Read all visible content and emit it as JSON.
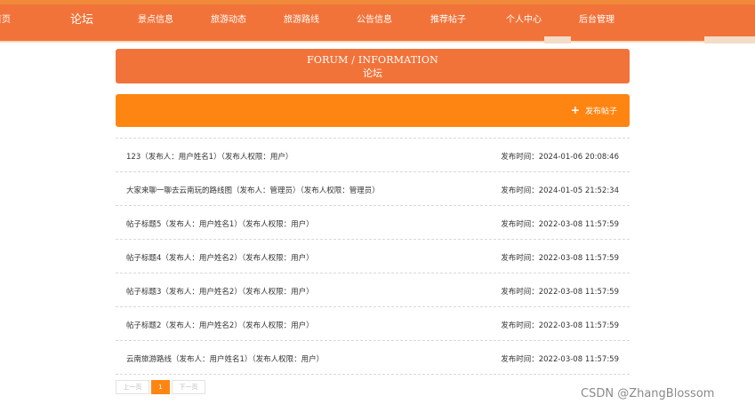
{
  "nav": {
    "items": [
      "首页",
      "论坛",
      "景点信息",
      "旅游动态",
      "旅游路线",
      "公告信息",
      "推荐帖子",
      "个人中心",
      "后台管理"
    ]
  },
  "page": {
    "title_en": "FORUM / INFORMATION",
    "title_cn": "论坛"
  },
  "actions": {
    "post_label": "发布帖子"
  },
  "posts": [
    {
      "title": "123（发布人：用户姓名1）（发布人权限：用户）",
      "time": "发布时间：2024-01-06 20:08:46"
    },
    {
      "title": "大家来聊一聊去云南玩的路线图（发布人：管理员）（发布人权限：管理员）",
      "time": "发布时间：2024-01-05 21:52:34"
    },
    {
      "title": "帖子标题5（发布人：用户姓名1）（发布人权限：用户）",
      "time": "发布时间：2022-03-08 11:57:59"
    },
    {
      "title": "帖子标题4（发布人：用户姓名2）（发布人权限：用户）",
      "time": "发布时间：2022-03-08 11:57:59"
    },
    {
      "title": "帖子标题3（发布人：用户姓名2）（发布人权限：用户）",
      "time": "发布时间：2022-03-08 11:57:59"
    },
    {
      "title": "帖子标题2（发布人：用户姓名2）（发布人权限：用户）",
      "time": "发布时间：2022-03-08 11:57:59"
    },
    {
      "title": "云南旅游路线（发布人：用户姓名1）（发布人权限：用户）",
      "time": "发布时间：2022-03-08 11:57:59"
    }
  ],
  "pagination": {
    "prev": "上一页",
    "current": "1",
    "next": "下一页"
  },
  "watermark": "CSDN @ZhangBlossom",
  "colors": {
    "header": "#f2733a",
    "action_bar": "#ff8513"
  }
}
